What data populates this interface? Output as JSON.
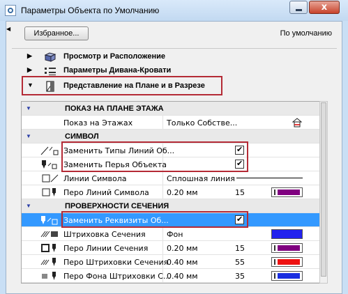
{
  "window": {
    "title": "Параметры Объекта по Умолчанию",
    "close_label": "x"
  },
  "toolbar": {
    "favorites_label": "Избранное...",
    "default_label": "По умолчанию"
  },
  "panels": [
    {
      "label": "Просмотр и Расположение",
      "expanded": false
    },
    {
      "label": "Параметры Дивана-Кровати",
      "expanded": false
    },
    {
      "label": "Представление на Плане и в Разрезе",
      "expanded": true
    }
  ],
  "table": {
    "groups": {
      "floor_plan": "ПОКАЗ НА ПЛАНЕ ЭТАЖА",
      "symbol": "СИМВОЛ",
      "cut_surfaces": "ПРОВЕРХНОСТИ СЕЧЕНИЯ"
    },
    "rows": {
      "show_on_stories": {
        "name": "Показ на Этажах",
        "value": "Только Собстве..."
      },
      "override_line_types": {
        "name": "Заменить Типы Линий Об...",
        "checked": true
      },
      "override_pens": {
        "name": "Заменить Перья Объекта",
        "checked": true
      },
      "symbol_lines": {
        "name": "Линии Символа",
        "value": "Сплошная линия"
      },
      "symbol_line_pen": {
        "name": "Перо Линий Символа",
        "value": "0.20 мм",
        "num": "15",
        "color": "#800080"
      },
      "override_fills": {
        "name": "Заменить Реквизиты Об...",
        "checked": true
      },
      "cut_fill": {
        "name": "Штриховка Сечения",
        "value": "Фон",
        "color": "#2222ee"
      },
      "cut_line_pen": {
        "name": "Перо Линии Сечения",
        "value": "0.20 мм",
        "num": "15",
        "color": "#800080"
      },
      "cut_fill_pen": {
        "name": "Перо Штриховки Сечения",
        "value": "0.40 мм",
        "num": "55",
        "color": "#ee1111"
      },
      "cut_bg_pen": {
        "name": "Перо Фона Штриховки С...",
        "value": "0.40 мм",
        "num": "35",
        "color": "#1a2ee0"
      }
    }
  },
  "colors": {
    "selection": "#3399ff",
    "highlight_box": "#b42a35"
  }
}
